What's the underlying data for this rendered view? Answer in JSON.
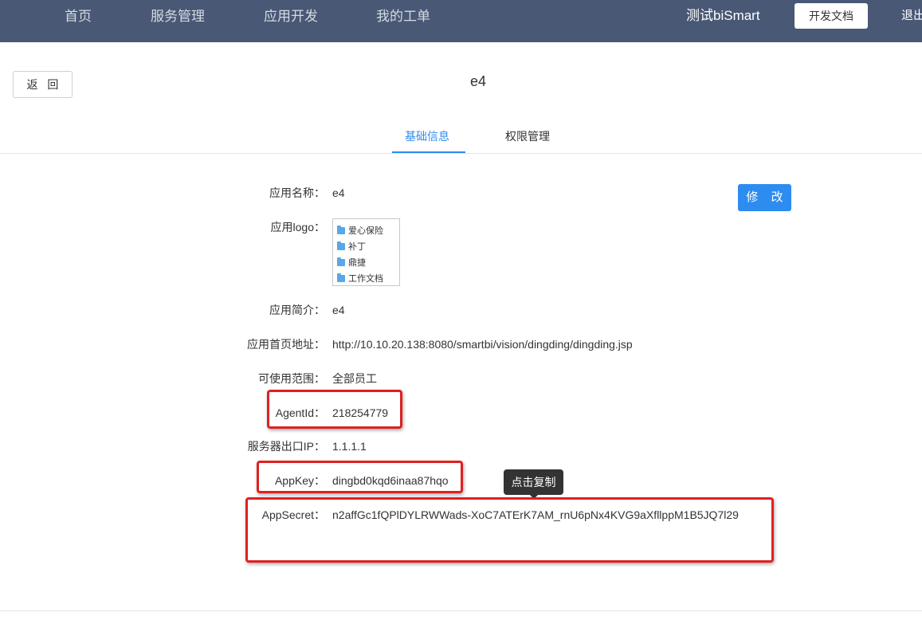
{
  "nav": {
    "items": [
      "首页",
      "服务管理",
      "应用开发",
      "我的工单"
    ],
    "user": "测试biSmart",
    "doc_button": "开发文档",
    "logout": "退出"
  },
  "page": {
    "back_button": "返 回",
    "title": "e4"
  },
  "tabs": [
    {
      "label": "基础信息",
      "active": true
    },
    {
      "label": "权限管理",
      "active": false
    }
  ],
  "edit_button": "修 改",
  "fields": {
    "name": {
      "label": "应用名称：",
      "value": "e4"
    },
    "logo": {
      "label": "应用logo：",
      "folders": [
        "爱心保险",
        "补丁",
        "鼎捷",
        "工作文档"
      ]
    },
    "intro": {
      "label": "应用简介：",
      "value": "e4"
    },
    "homepage": {
      "label": "应用首页地址：",
      "value": "http://10.10.20.138:8080/smartbi/vision/dingding/dingding.jsp"
    },
    "scope": {
      "label": "可使用范围：",
      "value": "全部员工"
    },
    "agentid": {
      "label": "AgentId：",
      "value": "218254779"
    },
    "server_ip": {
      "label": "服务器出口IP：",
      "value": "1.1.1.1"
    },
    "appkey": {
      "label": "AppKey：",
      "value": "dingbd0kqd6inaa87hqo"
    },
    "appsecret": {
      "label": "AppSecret：",
      "value": "n2affGc1fQPlDYLRWWads-XoC7ATErK7AM_rnU6pNx4KVG9aXfllppM1B5JQ7l29"
    }
  },
  "tooltip": "点击复制",
  "colors": {
    "topbar": "#485875",
    "accent": "#2d8cf0",
    "highlight": "#e02020"
  }
}
